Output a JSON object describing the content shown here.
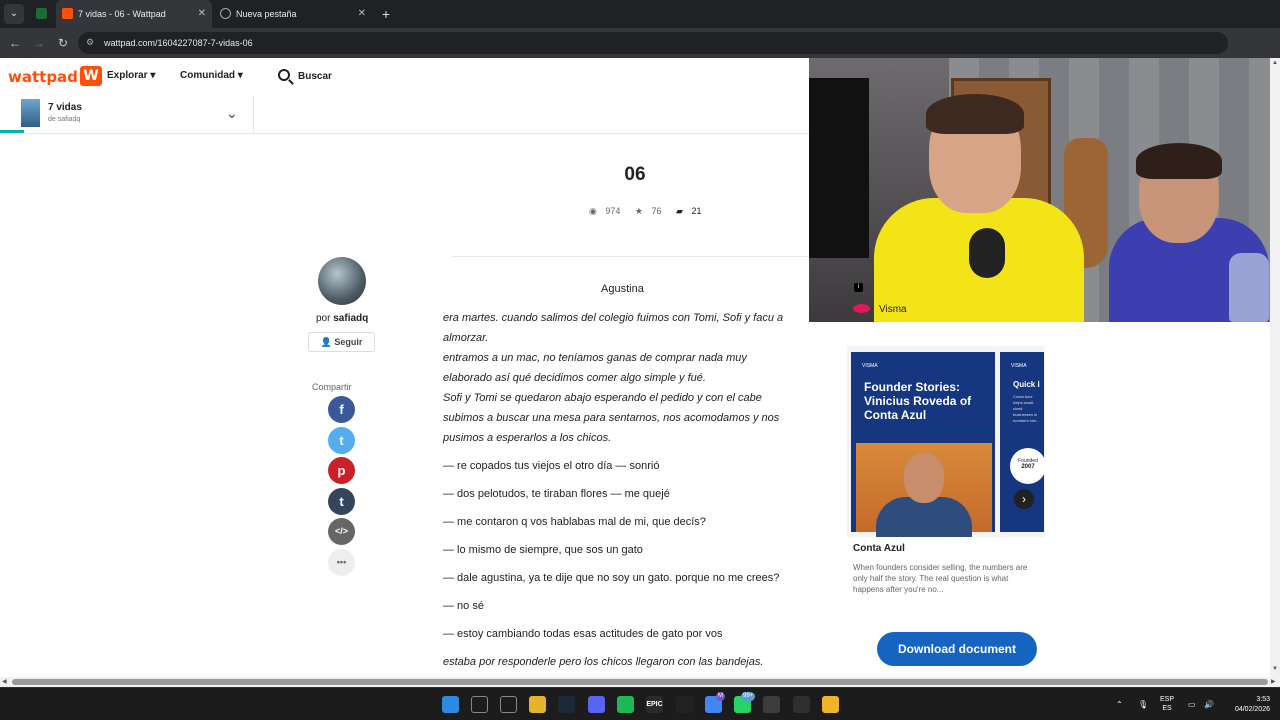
{
  "browser": {
    "tabs": [
      {
        "title": "7 vidas - 06 - Wattpad",
        "active": true
      },
      {
        "title": "Nueva pestaña",
        "active": false
      }
    ],
    "url": "wattpad.com/1604227087-7-vidas-06"
  },
  "header": {
    "logo": "wattpad",
    "logo_mark": "W",
    "nav": [
      {
        "label": "Explorar"
      },
      {
        "label": "Comunidad"
      }
    ],
    "search_label": "Buscar"
  },
  "story": {
    "title": "7 vidas",
    "author_line": "de safiadq",
    "reading_progress": 0.03
  },
  "chapter": {
    "title": "06",
    "views": "974",
    "votes": "76",
    "comments": "21"
  },
  "author": {
    "by": "por",
    "name": "safiadq",
    "follow_label": "Seguir"
  },
  "share": {
    "label": "Compartir",
    "buttons": [
      {
        "icon": "facebook-icon",
        "glyph": "f",
        "color": "#3b5998"
      },
      {
        "icon": "twitter-icon",
        "glyph": "t",
        "color": "#55acee"
      },
      {
        "icon": "pinterest-icon",
        "glyph": "p",
        "color": "#cb2027"
      },
      {
        "icon": "tumblr-icon",
        "glyph": "t",
        "color": "#35465c"
      },
      {
        "icon": "embed-icon",
        "glyph": "</>",
        "color": "#666666"
      },
      {
        "icon": "more-icon",
        "glyph": "•••",
        "color": "#eeeeee"
      }
    ]
  },
  "text": {
    "heading": "Agustina",
    "paragraphs": [
      {
        "lines": [
          "era martes. cuando salimos del colegio fuimos con Tomi, Sofi y facu a",
          "almorzar.",
          "entramos a un mac, no teníamos ganas de comprar nada muy",
          "elaborado así qué decidimos comer algo simple y fué.",
          "Sofi y Tomi se quedaron abajo esperando el pedido y con el cabe",
          "subimos a buscar una mesa para sentarnos, nos acomodamos y nos",
          "pusimos a esperarlos a los chicos."
        ],
        "italic": true
      },
      {
        "lines": [
          "— re copados tus viejos el otro día — sonrió"
        ],
        "italic": false
      },
      {
        "lines": [
          "— dos pelotudos, te tiraban flores — me quejé"
        ],
        "italic": false
      },
      {
        "lines": [
          "— me contaron q vos hablabas mal de mi, que decís?"
        ],
        "italic": false
      },
      {
        "lines": [
          "— lo mismo de siempre, que sos un gato"
        ],
        "italic": false
      },
      {
        "lines": [
          "— dale agustina, ya te dije que no soy un gato. porque no me crees?"
        ],
        "italic": false
      },
      {
        "lines": [
          "— no sé"
        ],
        "italic": false
      },
      {
        "lines": [
          "— estoy cambiando todas esas actitudes de gato por vos"
        ],
        "italic": false
      },
      {
        "lines": [
          "estaba por responderle pero los chicos llegaron con las bandejas."
        ],
        "italic": true
      }
    ]
  },
  "ad": {
    "badge": "i",
    "brand": "Visma",
    "card1_mini": "VISMA",
    "card1_headline": "Founder Stories: Vinicius Roveda of Conta Azul",
    "card2_mini": "VISMA",
    "card2_headline": "Quick I",
    "card2_small": "Conta Azul helps small-sized businesses in numbers into...",
    "card2_circle_label": "Founded",
    "card2_circle_year": "2007",
    "company": "Conta Azul",
    "description": "When founders consider selling, the numbers are only half the story. The real question is what happens after you're no...",
    "download_label": "Download document"
  },
  "taskbar": {
    "icons": [
      {
        "name": "windows-start-icon",
        "color": "#2b8ae2",
        "label": ""
      },
      {
        "name": "search-icon",
        "color": "#1c1c1c",
        "label": ""
      },
      {
        "name": "task-view-icon",
        "color": "#1c1c1c",
        "label": ""
      },
      {
        "name": "file-explorer-icon",
        "color": "#e8b32c",
        "label": ""
      },
      {
        "name": "steam-icon",
        "color": "#1b2838",
        "label": ""
      },
      {
        "name": "discord-icon",
        "color": "#5865f2",
        "label": ""
      },
      {
        "name": "spotify-icon",
        "color": "#1db954",
        "label": ""
      },
      {
        "name": "epic-games-icon",
        "color": "#2a2a2a",
        "label": "EPIC"
      },
      {
        "name": "capcut-icon",
        "color": "#222222",
        "label": ""
      },
      {
        "name": "chrome-icon",
        "color": "#4285f4",
        "label": ""
      },
      {
        "name": "whatsapp-icon",
        "color": "#25d366",
        "label": ""
      },
      {
        "name": "snipping-tool-icon",
        "color": "#3d3d3d",
        "label": ""
      },
      {
        "name": "obs-icon",
        "color": "#302e31",
        "label": ""
      },
      {
        "name": "chrome-alt-icon",
        "color": "#f0b429",
        "label": ""
      }
    ],
    "whatsapp_badge": "99+",
    "chrome_badge": "M",
    "lang_line1": "ESP",
    "lang_line2": "ES",
    "time": "3:53",
    "date": "04/02/2026"
  }
}
